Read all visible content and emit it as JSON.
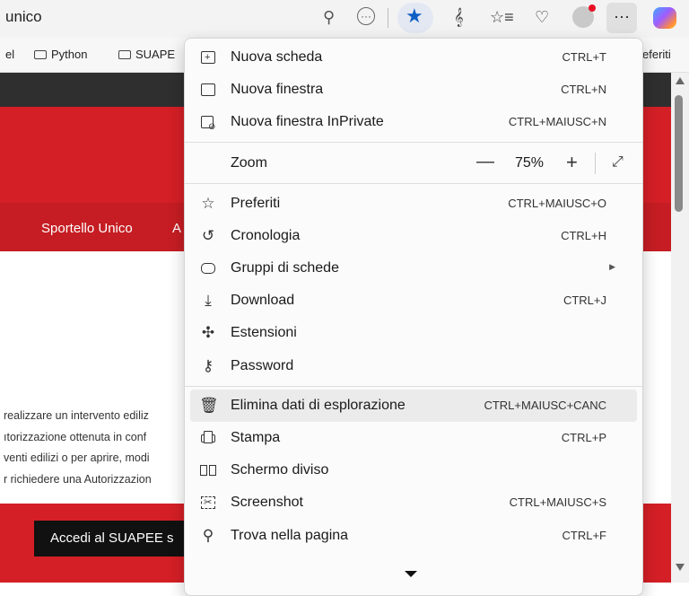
{
  "address_bar": {
    "url_text": "unico",
    "zoom_icon": "zoom-out-icon",
    "more_icon": "circle-ellipsis-icon",
    "favorite_icon": "star-icon",
    "read_aloud_icon": "read-aloud-icon",
    "favorites_icon": "favorites-list-icon",
    "health_icon": "heart-pulse-icon",
    "settings_icon": "ellipsis-icon",
    "settings_label": "···"
  },
  "favorites_bar": {
    "items": [
      {
        "label": "el"
      },
      {
        "label": "Python"
      },
      {
        "label": "SUAPE"
      }
    ],
    "overflow_label": "eferiti"
  },
  "page": {
    "nav_items": [
      {
        "label": "Sportello Unico"
      },
      {
        "label": "A"
      }
    ],
    "paragraph_lines": [
      "realizzare un intervento ediliz",
      "ıtorizzazione ottenuta in conf",
      "venti edilizi o per aprire, modi",
      "r richiedere una Autorizzazion"
    ],
    "button_label": "Accedi al SUAPEE s"
  },
  "menu": {
    "items": [
      {
        "label": "Nuova scheda",
        "shortcut": "CTRL+T",
        "icon": "new-tab-icon"
      },
      {
        "label": "Nuova finestra",
        "shortcut": "CTRL+N",
        "icon": "new-window-icon"
      },
      {
        "label": "Nuova finestra InPrivate",
        "shortcut": "CTRL+MAIUSC+N",
        "icon": "inprivate-icon"
      },
      {
        "label": "Preferiti",
        "shortcut": "CTRL+MAIUSC+O",
        "icon": "favorites-icon"
      },
      {
        "label": "Cronologia",
        "shortcut": "CTRL+H",
        "icon": "history-icon"
      },
      {
        "label": "Gruppi di schede",
        "shortcut": "",
        "icon": "tab-groups-icon"
      },
      {
        "label": "Download",
        "shortcut": "CTRL+J",
        "icon": "download-icon"
      },
      {
        "label": "Estensioni",
        "shortcut": "",
        "icon": "extensions-icon"
      },
      {
        "label": "Password",
        "shortcut": "",
        "icon": "key-icon"
      },
      {
        "label": "Elimina dati di esplorazione",
        "shortcut": "CTRL+MAIUSC+CANC",
        "icon": "trash-icon"
      },
      {
        "label": "Stampa",
        "shortcut": "CTRL+P",
        "icon": "print-icon"
      },
      {
        "label": "Schermo diviso",
        "shortcut": "",
        "icon": "split-screen-icon"
      },
      {
        "label": "Screenshot",
        "shortcut": "CTRL+MAIUSC+S",
        "icon": "screenshot-icon"
      },
      {
        "label": "Trova nella pagina",
        "shortcut": "CTRL+F",
        "icon": "find-icon"
      }
    ],
    "zoom": {
      "label": "Zoom",
      "value": "75%",
      "minus": "—",
      "plus": "+"
    },
    "highlighted_item": "Elimina dati di esplorazione"
  },
  "colors": {
    "accent": "#0f5ec4",
    "page_red": "#d41f26",
    "page_dark": "#2f2f2f"
  }
}
